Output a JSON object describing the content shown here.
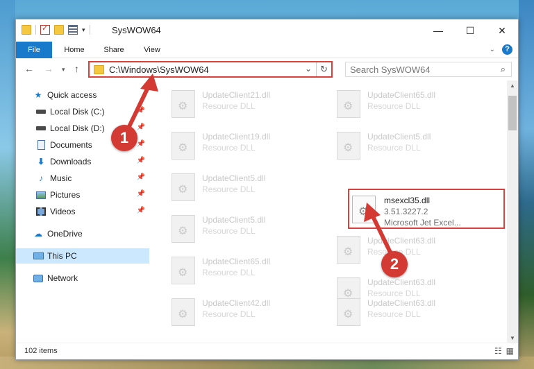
{
  "window": {
    "title": "SysWOW64",
    "min_icon": "minimize-icon",
    "max_icon": "maximize-icon",
    "close_icon": "close-icon"
  },
  "ribbon": {
    "tabs": [
      "File",
      "Home",
      "Share",
      "View"
    ],
    "help": "?"
  },
  "navbar": {
    "address": "C:\\Windows\\SysWOW64",
    "search_placeholder": "Search SysWOW64"
  },
  "sidebar": {
    "items": [
      {
        "label": "Quick access",
        "icon": "star-icon"
      },
      {
        "label": "Local Disk (C:)",
        "icon": "drive-icon"
      },
      {
        "label": "Local Disk (D:)",
        "icon": "drive-icon"
      },
      {
        "label": "Documents",
        "icon": "documents-icon"
      },
      {
        "label": "Downloads",
        "icon": "download-icon"
      },
      {
        "label": "Music",
        "icon": "music-icon"
      },
      {
        "label": "Pictures",
        "icon": "pictures-icon"
      },
      {
        "label": "Videos",
        "icon": "videos-icon"
      },
      {
        "label": "OneDrive",
        "icon": "cloud-icon"
      },
      {
        "label": "This PC",
        "icon": "computer-icon"
      },
      {
        "label": "Network",
        "icon": "network-icon"
      }
    ]
  },
  "files": [
    {
      "name": "UpdateClient21.dll",
      "desc": "Resource DLL"
    },
    {
      "name": "UpdateClient65.dll",
      "desc": "Resource DLL"
    },
    {
      "name": "UpdateClient19.dll",
      "desc": "Resource DLL"
    },
    {
      "name": "UpdateClient5.dll",
      "desc": "Resource DLL"
    },
    {
      "name": "UpdateClient5.dll",
      "desc": "Resource DLL"
    },
    {
      "name": "msexcl35.dll",
      "desc": "3.51.3227.2",
      "desc2": "Microsoft Jet Excel..."
    },
    {
      "name": "UpdateClient5.dll",
      "desc": "Resource DLL"
    },
    {
      "name": "UpdateClient63.dll",
      "desc": "Resource DLL"
    },
    {
      "name": "UpdateClient65.dll",
      "desc": "Resource DLL"
    },
    {
      "name": "UpdateClient63.dll",
      "desc": "Resource DLL"
    },
    {
      "name": "UpdateClient42.dll",
      "desc": "Resource DLL"
    },
    {
      "name": "UpdateClient63.dll",
      "desc": "Resource DLL"
    }
  ],
  "status": {
    "items": "102 items"
  },
  "callouts": [
    "1",
    "2"
  ],
  "colors": {
    "accent": "#1979ca",
    "highlight": "#d9413a",
    "selected": "#cce8ff"
  }
}
